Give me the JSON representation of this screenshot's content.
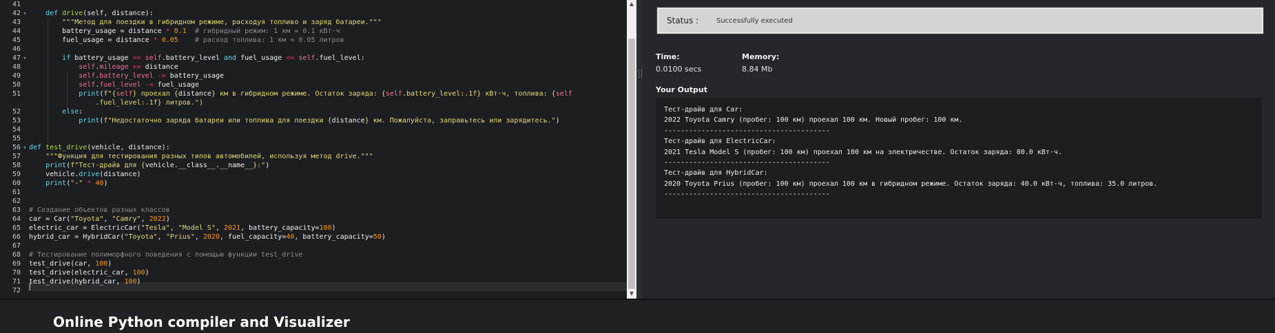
{
  "editor": {
    "line_numbers": [
      "41",
      "42",
      "43",
      "44",
      "45",
      "46",
      "47",
      "48",
      "49",
      "50",
      "51",
      "",
      "52",
      "53",
      "54",
      "55",
      "56",
      "57",
      "58",
      "59",
      "60",
      "61",
      "62",
      "63",
      "64",
      "65",
      "66",
      "67",
      "68",
      "69",
      "70",
      "71",
      "72"
    ],
    "lines": [
      [
        [
          "t",
          "    "
        ]
      ],
      [
        [
          "t",
          "    "
        ],
        [
          "kw",
          "def "
        ],
        [
          "fn",
          "drive"
        ],
        [
          "t",
          "(self, distance):"
        ]
      ],
      [
        [
          "t",
          "        "
        ],
        [
          "st",
          "\"\"\"Метод для поездки в гибридном режиме, расходуя топливо и заряд батареи.\"\"\""
        ]
      ],
      [
        [
          "t",
          "        battery_usage = distance "
        ],
        [
          "op",
          "*"
        ],
        [
          "t",
          " "
        ],
        [
          "nm",
          "0.1"
        ],
        [
          "t",
          "  "
        ],
        [
          "cm",
          "# гибридный режим: 1 км = 0.1 кВт·ч"
        ]
      ],
      [
        [
          "t",
          "        fuel_usage = distance "
        ],
        [
          "op",
          "*"
        ],
        [
          "t",
          " "
        ],
        [
          "nm",
          "0.05"
        ],
        [
          "t",
          "    "
        ],
        [
          "cm",
          "# расход топлива: 1 км = 0.05 литров"
        ]
      ],
      [
        [
          "t",
          ""
        ]
      ],
      [
        [
          "t",
          "        "
        ],
        [
          "kw",
          "if"
        ],
        [
          "t",
          " battery_usage "
        ],
        [
          "op",
          "<="
        ],
        [
          "t",
          " "
        ],
        [
          "sf",
          "self"
        ],
        [
          "t",
          ".battery_level "
        ],
        [
          "kw",
          "and"
        ],
        [
          "t",
          " fuel_usage "
        ],
        [
          "op",
          "<="
        ],
        [
          "t",
          " "
        ],
        [
          "sf",
          "self"
        ],
        [
          "t",
          ".fuel_level:"
        ]
      ],
      [
        [
          "t",
          "            "
        ],
        [
          "sf",
          "self"
        ],
        [
          "t",
          "."
        ],
        [
          "sf",
          "mileage"
        ],
        [
          "t",
          " "
        ],
        [
          "op",
          "+="
        ],
        [
          "t",
          " distance"
        ]
      ],
      [
        [
          "t",
          "            "
        ],
        [
          "sf",
          "self"
        ],
        [
          "t",
          "."
        ],
        [
          "sf",
          "battery_level"
        ],
        [
          "t",
          " "
        ],
        [
          "op",
          "-="
        ],
        [
          "t",
          " battery_usage"
        ]
      ],
      [
        [
          "t",
          "            "
        ],
        [
          "sf",
          "self"
        ],
        [
          "t",
          "."
        ],
        [
          "sf",
          "fuel_level"
        ],
        [
          "t",
          " "
        ],
        [
          "op",
          "-="
        ],
        [
          "t",
          " fuel_usage"
        ]
      ],
      [
        [
          "t",
          "            "
        ],
        [
          "bi",
          "print"
        ],
        [
          "t",
          "("
        ],
        [
          "st",
          "f\"{"
        ],
        [
          "sf",
          "self"
        ],
        [
          "st",
          "} проехал {"
        ],
        [
          "t",
          "distance"
        ],
        [
          "st",
          "} км в гибридном режиме. Остаток заряда: {"
        ],
        [
          "sf",
          "self"
        ],
        [
          "st",
          ".battery_level:.1f} кВт·ч, топлива: {"
        ],
        [
          "sf",
          "self"
        ]
      ],
      [
        [
          "t",
          "                "
        ],
        [
          "st",
          ".fuel_level:.1f} литров.\")"
        ]
      ],
      [
        [
          "t",
          "        "
        ],
        [
          "kw",
          "else"
        ],
        [
          "t",
          ":"
        ]
      ],
      [
        [
          "t",
          "            "
        ],
        [
          "bi",
          "print"
        ],
        [
          "t",
          "("
        ],
        [
          "st",
          "f\"Недостаточно заряда батареи или топлива для поездки {"
        ],
        [
          "t",
          "distance"
        ],
        [
          "st",
          "} км. Пожалуйста, заправьтесь или зарядитесь.\""
        ],
        [
          "t",
          ")"
        ]
      ],
      [
        [
          "t",
          ""
        ]
      ],
      [
        [
          "t",
          ""
        ]
      ],
      [
        [
          "kw",
          "def "
        ],
        [
          "fn",
          "test_drive"
        ],
        [
          "t",
          "(vehicle, distance):"
        ]
      ],
      [
        [
          "t",
          "    "
        ],
        [
          "st",
          "\"\"\"Функция для тестирования разных типов автомобилей, используя метод drive.\"\"\""
        ]
      ],
      [
        [
          "t",
          "    "
        ],
        [
          "bi",
          "print"
        ],
        [
          "t",
          "("
        ],
        [
          "st",
          "f\"Тест-драйв для {"
        ],
        [
          "t",
          "vehicle.__class__.__name__"
        ],
        [
          "st",
          "}:\""
        ],
        [
          "t",
          ")"
        ]
      ],
      [
        [
          "t",
          "    vehicle."
        ],
        [
          "bi",
          "drive"
        ],
        [
          "t",
          "(distance)"
        ]
      ],
      [
        [
          "t",
          "    "
        ],
        [
          "bi",
          "print"
        ],
        [
          "t",
          "("
        ],
        [
          "st",
          "\"-\""
        ],
        [
          "t",
          " "
        ],
        [
          "op",
          "*"
        ],
        [
          "t",
          " "
        ],
        [
          "nm",
          "40"
        ],
        [
          "t",
          ")"
        ]
      ],
      [
        [
          "t",
          ""
        ]
      ],
      [
        [
          "t",
          ""
        ]
      ],
      [
        [
          "cm",
          "# Создание объектов разных классов"
        ]
      ],
      [
        [
          "t",
          "car = Car("
        ],
        [
          "st",
          "\"Toyota\""
        ],
        [
          "t",
          ", "
        ],
        [
          "st",
          "\"Camry\""
        ],
        [
          "t",
          ", "
        ],
        [
          "nm",
          "2022"
        ],
        [
          "t",
          ")"
        ]
      ],
      [
        [
          "t",
          "electric_car = ElectricCar("
        ],
        [
          "st",
          "\"Tesla\""
        ],
        [
          "t",
          ", "
        ],
        [
          "st",
          "\"Model S\""
        ],
        [
          "t",
          ", "
        ],
        [
          "nm",
          "2021"
        ],
        [
          "t",
          ", battery_capacity="
        ],
        [
          "nm",
          "100"
        ],
        [
          "t",
          ")"
        ]
      ],
      [
        [
          "t",
          "hybrid_car = HybridCar("
        ],
        [
          "st",
          "\"Toyota\""
        ],
        [
          "t",
          ", "
        ],
        [
          "st",
          "\"Prius\""
        ],
        [
          "t",
          ", "
        ],
        [
          "nm",
          "2020"
        ],
        [
          "t",
          ", fuel_capacity="
        ],
        [
          "nm",
          "40"
        ],
        [
          "t",
          ", battery_capacity="
        ],
        [
          "nm",
          "50"
        ],
        [
          "t",
          ")"
        ]
      ],
      [
        [
          "t",
          ""
        ]
      ],
      [
        [
          "cm",
          "# Тестирование полиморфного поведения с помощью функции test_drive"
        ]
      ],
      [
        [
          "t",
          "test_drive(car, "
        ],
        [
          "nm",
          "100"
        ],
        [
          "t",
          ")"
        ]
      ],
      [
        [
          "t",
          "test_drive(electric_car, "
        ],
        [
          "nm",
          "100"
        ],
        [
          "t",
          ")"
        ]
      ],
      [
        [
          "t",
          "test_drive(hybrid_car, "
        ],
        [
          "nm",
          "100"
        ],
        [
          "t",
          ")"
        ]
      ],
      [
        [
          "t",
          ""
        ]
      ]
    ]
  },
  "output": {
    "status_label": "Status :",
    "status_value": "Successfully executed",
    "time_label": "Time:",
    "time_value": "0.0100 secs",
    "memory_label": "Memory:",
    "memory_value": "8.84 Mb",
    "your_output_title": "Your Output",
    "lines": [
      "Тест-драйв для Car:",
      "2022 Toyota Camry (пробег: 100 км) проехал 100 км. Новый пробег: 100 км.",
      "----------------------------------------",
      "Тест-драйв для ElectricCar:",
      "2021 Tesla Model S (пробег: 100 км) проехал 100 км на электричестве. Остаток заряда: 80.0 кВт·ч.",
      "----------------------------------------",
      "Тест-драйв для HybridCar:",
      "2020 Toyota Prius (пробег: 100 км) проехал 100 км в гибридном режиме. Остаток заряда: 40.0 кВт·ч, топлива: 35.0 литров.",
      "----------------------------------------"
    ]
  },
  "footer": {
    "title": "Online Python compiler and Visualizer"
  },
  "icons": {
    "fold_open": "▾",
    "scroll_up": "▲",
    "scroll_down": "▼"
  }
}
